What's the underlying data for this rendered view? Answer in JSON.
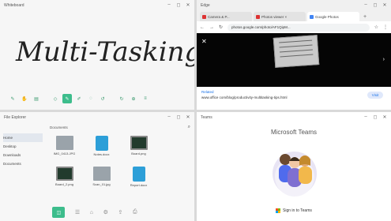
{
  "windows": {
    "whiteboard": {
      "title": "Whiteboard",
      "handwriting": "Multi-Tasking",
      "controls": [
        "–",
        "◻",
        "✕"
      ],
      "tools": [
        {
          "icon": "pen-icon",
          "glyph": "✎"
        },
        {
          "icon": "hand-icon",
          "glyph": "✋"
        },
        {
          "icon": "folder-icon",
          "glyph": "▤"
        },
        {
          "icon": "shape-icon",
          "glyph": "◇"
        },
        {
          "icon": "pen-tool-icon",
          "glyph": "✎"
        },
        {
          "icon": "marker-icon",
          "glyph": "✐"
        },
        {
          "icon": "eraser-icon",
          "glyph": "◌"
        },
        {
          "icon": "undo-icon",
          "glyph": "↺"
        },
        {
          "icon": "redo-icon",
          "glyph": "↻"
        },
        {
          "icon": "zoom-icon",
          "glyph": "⊕"
        },
        {
          "icon": "layers-icon",
          "glyph": "≡"
        }
      ]
    },
    "browser": {
      "title": "Edge",
      "tabs": [
        {
          "label": "Camera & P...",
          "active": false
        },
        {
          "label": "Photos viewer ×",
          "active": false
        },
        {
          "label": "Google Photos",
          "active": true
        }
      ],
      "new_tab": "+",
      "url": "photos.google.com/photo/AF1QipM...",
      "infobar": {
        "tag": "Related",
        "text": "www.office com/blog/productivity-multitasking-tips.html",
        "visit": "Visit"
      },
      "controls": [
        "–",
        "◻",
        "✕"
      ]
    },
    "explorer": {
      "title": "File Explorer",
      "crumb": "Documents",
      "sidebar": [
        "Home",
        "Desktop",
        "Downloads",
        "Documents"
      ],
      "files": [
        {
          "name": "IMG_0413.JPG",
          "kind": "gray"
        },
        {
          "name": "Notes.docx",
          "kind": "doc"
        },
        {
          "name": "Board.png",
          "kind": "dark"
        },
        {
          "name": "Board_2.png",
          "kind": "dark"
        },
        {
          "name": "Scan_01.jpg",
          "kind": "gray"
        },
        {
          "name": "Report.docx",
          "kind": "doc"
        }
      ],
      "dock": [
        "◫",
        "☰",
        "⌂",
        "⚙",
        "⇪",
        "⎙"
      ],
      "controls": [
        "–",
        "◻",
        "✕"
      ]
    },
    "teams": {
      "title": "Teams",
      "heading": "Microsoft Teams",
      "signin": "Sign in to Teams",
      "controls": [
        "–",
        "◻",
        "✕"
      ]
    }
  }
}
